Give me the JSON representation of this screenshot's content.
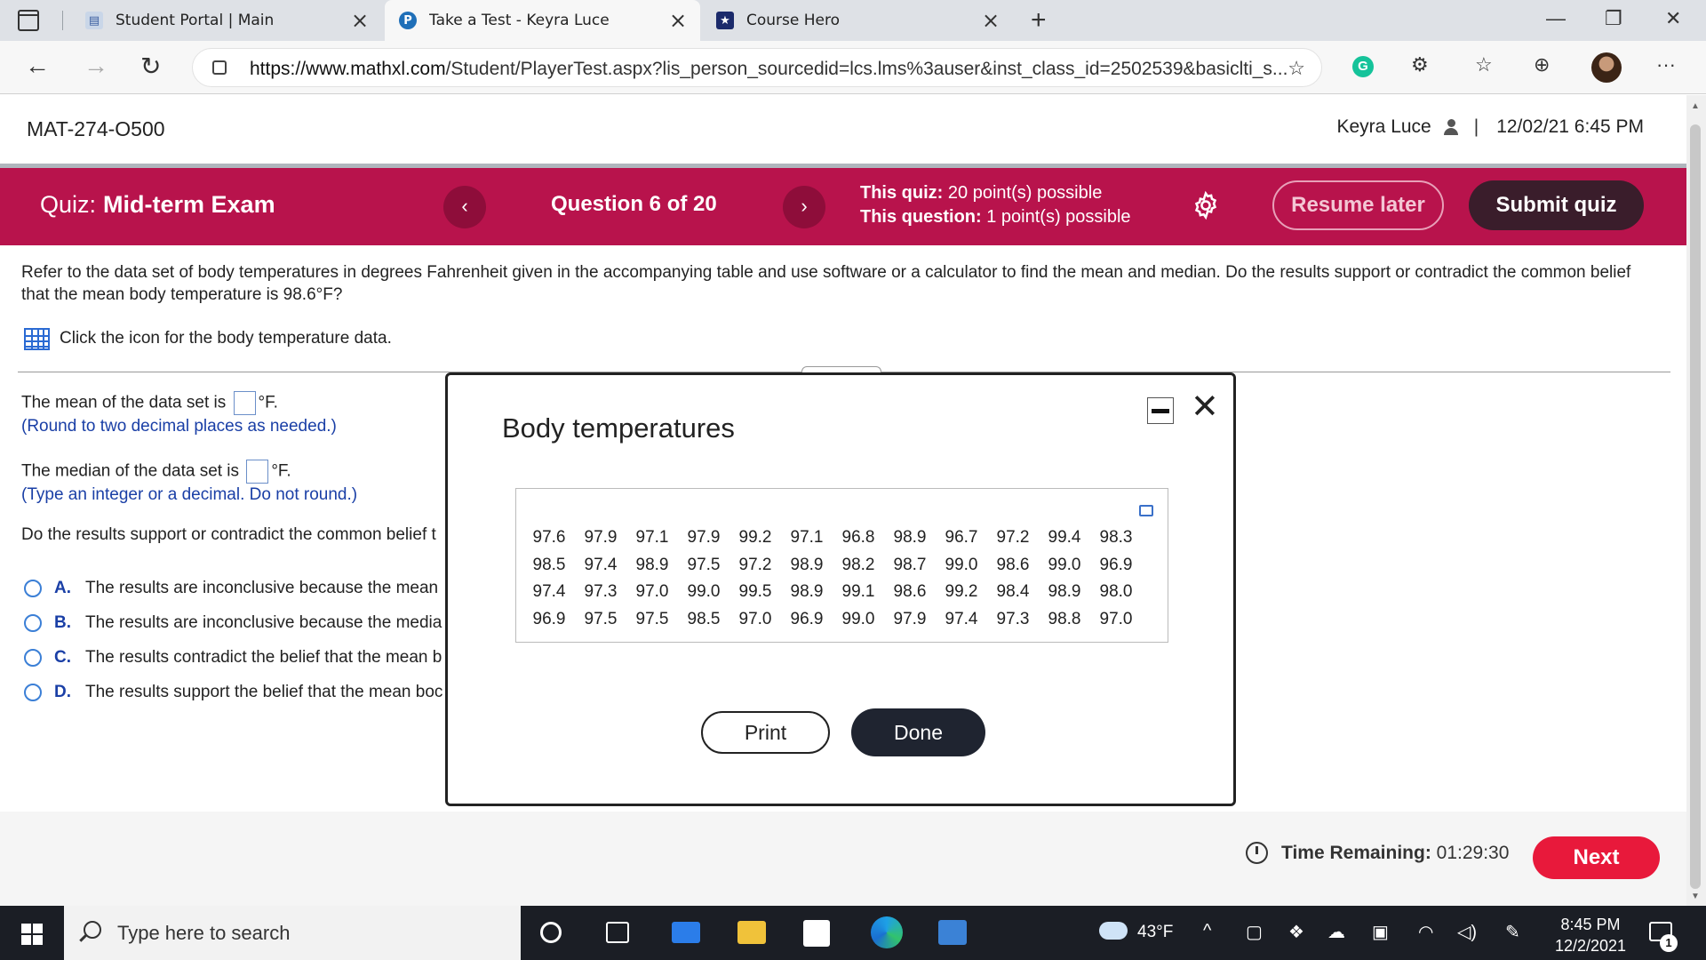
{
  "browser": {
    "tabs": [
      {
        "title": "Student Portal | Main"
      },
      {
        "title": "Take a Test - Keyra Luce"
      },
      {
        "title": "Course Hero"
      }
    ],
    "url_host": "https://www.mathxl.com",
    "url_path": "/Student/PlayerTest.aspx?lis_person_sourcedid=lcs.lms%3auser&inst_class_id=2502539&basiclti_s..."
  },
  "header": {
    "course": "MAT-274-O500",
    "user": "Keyra Luce",
    "separator": "|",
    "datetime": "12/02/21 6:45 PM"
  },
  "quizbar": {
    "label": "Quiz:",
    "name": "Mid-term Exam",
    "prev_glyph": "‹",
    "next_glyph": "›",
    "question": "Question 6 of 20",
    "quiz_points_label": "This quiz:",
    "quiz_points_value": "20 point(s) possible",
    "question_points_label": "This question:",
    "question_points_value": "1 point(s) possible",
    "resume_label": "Resume later",
    "submit_label": "Submit quiz"
  },
  "question": {
    "prompt": "Refer to the data set of body temperatures in degrees Fahrenheit given in the accompanying table and use software or a calculator to find the mean and median. Do the results support or contradict the common belief that the mean body temperature is 98.6°F?",
    "data_link": "Click the icon for the body temperature data.",
    "mean_prefix": "The mean of the data set is",
    "unit": "°F.",
    "mean_hint": "(Round to two decimal places as needed.)",
    "median_prefix": "The median of the data set is",
    "median_hint": "(Type an integer or a decimal. Do not round.)",
    "support_question": "Do the results support or contradict the common belief t",
    "options": [
      {
        "letter": "A.",
        "text": "The results are inconclusive because the mean"
      },
      {
        "letter": "B.",
        "text": "The results are inconclusive because the media"
      },
      {
        "letter": "C.",
        "text": "The results contradict the belief that the mean b"
      },
      {
        "letter": "D.",
        "text": "The results support the belief that the mean boc"
      }
    ]
  },
  "modal": {
    "title": "Body temperatures",
    "rows": [
      [
        "97.6",
        "97.9",
        "97.1",
        "97.9",
        "99.2",
        "97.1",
        "96.8",
        "98.9",
        "96.7",
        "97.2",
        "99.4",
        "98.3"
      ],
      [
        "98.5",
        "97.4",
        "98.9",
        "97.5",
        "97.2",
        "98.9",
        "98.2",
        "98.7",
        "99.0",
        "98.6",
        "99.0",
        "96.9"
      ],
      [
        "97.4",
        "97.3",
        "97.0",
        "99.0",
        "99.5",
        "98.9",
        "99.1",
        "98.6",
        "99.2",
        "98.4",
        "98.9",
        "98.0"
      ],
      [
        "96.9",
        "97.5",
        "97.5",
        "98.5",
        "97.0",
        "96.9",
        "99.0",
        "97.9",
        "97.4",
        "97.3",
        "98.8",
        "97.0"
      ]
    ],
    "print_label": "Print",
    "done_label": "Done"
  },
  "footer": {
    "time_label": "Time Remaining:",
    "time_value": "01:29:30",
    "next_label": "Next"
  },
  "taskbar": {
    "search_placeholder": "Type here to search",
    "weather": "43°F",
    "time": "8:45 PM",
    "date": "12/2/2021",
    "notifications": "1"
  }
}
